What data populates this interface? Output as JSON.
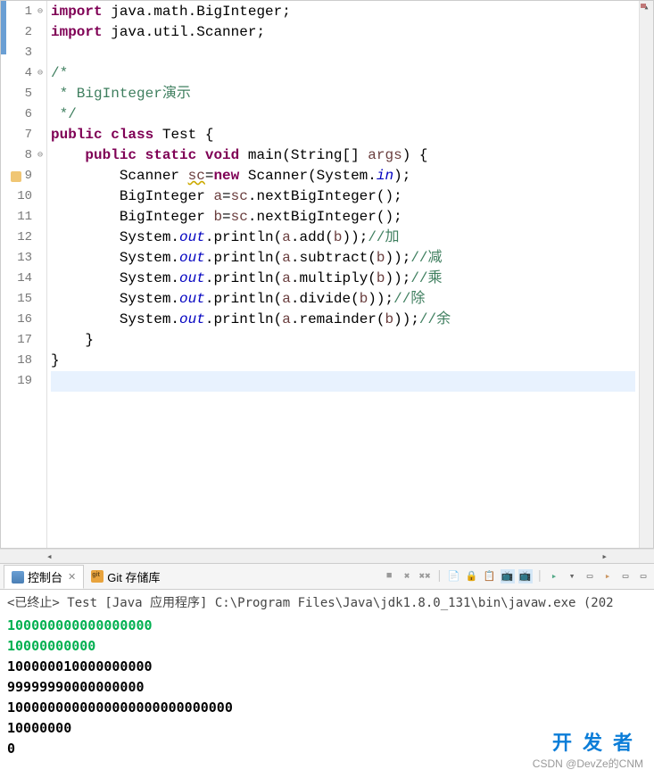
{
  "code": {
    "lines": [
      {
        "n": "1",
        "fold": "⊖",
        "html": "<span class='kw'>import</span> <span class='normal'>java.math.BigInteger;</span>"
      },
      {
        "n": "2",
        "fold": "",
        "html": "<span class='kw'>import</span> <span class='normal'>java.util.Scanner;</span>"
      },
      {
        "n": "3",
        "fold": "",
        "html": ""
      },
      {
        "n": "4",
        "fold": "⊖",
        "html": "<span class='comment'>/*</span>"
      },
      {
        "n": "5",
        "fold": "",
        "html": "<span class='comment'> * BigInteger演示</span>"
      },
      {
        "n": "6",
        "fold": "",
        "html": "<span class='comment'> */</span>"
      },
      {
        "n": "7",
        "fold": "",
        "html": "<span class='kw'>public</span> <span class='kw'>class</span> <span class='normal'>Test {</span>"
      },
      {
        "n": "8",
        "fold": "⊖",
        "html": "    <span class='kw'>public</span> <span class='kw'>static</span> <span class='kw'>void</span> <span class='normal'>main(String[] </span><span class='local-var'>args</span><span class='normal'>) {</span>"
      },
      {
        "n": "9",
        "fold": "",
        "marker": true,
        "html": "        <span class='normal'>Scanner </span><span class='local-var underline'>sc</span><span class='normal'>=</span><span class='kw'>new</span> <span class='normal'>Scanner(System.</span><span class='static-field'>in</span><span class='normal'>);</span>"
      },
      {
        "n": "10",
        "fold": "",
        "html": "        <span class='normal'>BigInteger </span><span class='local-var'>a</span><span class='normal'>=</span><span class='local-var'>sc</span><span class='normal'>.nextBigInteger();</span>"
      },
      {
        "n": "11",
        "fold": "",
        "html": "        <span class='normal'>BigInteger </span><span class='local-var'>b</span><span class='normal'>=</span><span class='local-var'>sc</span><span class='normal'>.nextBigInteger();</span>"
      },
      {
        "n": "12",
        "fold": "",
        "html": "        <span class='normal'>System.</span><span class='static-field'>out</span><span class='normal'>.println(</span><span class='local-var'>a</span><span class='normal'>.add(</span><span class='local-var'>b</span><span class='normal'>));</span><span class='comment'>//加</span>"
      },
      {
        "n": "13",
        "fold": "",
        "html": "        <span class='normal'>System.</span><span class='static-field'>out</span><span class='normal'>.println(</span><span class='local-var'>a</span><span class='normal'>.subtract(</span><span class='local-var'>b</span><span class='normal'>));</span><span class='comment'>//减</span>"
      },
      {
        "n": "14",
        "fold": "",
        "html": "        <span class='normal'>System.</span><span class='static-field'>out</span><span class='normal'>.println(</span><span class='local-var'>a</span><span class='normal'>.multiply(</span><span class='local-var'>b</span><span class='normal'>));</span><span class='comment'>//乘</span>"
      },
      {
        "n": "15",
        "fold": "",
        "html": "        <span class='normal'>System.</span><span class='static-field'>out</span><span class='normal'>.println(</span><span class='local-var'>a</span><span class='normal'>.divide(</span><span class='local-var'>b</span><span class='normal'>));</span><span class='comment'>//除</span>"
      },
      {
        "n": "16",
        "fold": "",
        "html": "        <span class='normal'>System.</span><span class='static-field'>out</span><span class='normal'>.println(</span><span class='local-var'>a</span><span class='normal'>.remainder(</span><span class='local-var'>b</span><span class='normal'>));</span><span class='comment'>//余</span>"
      },
      {
        "n": "17",
        "fold": "",
        "html": "    <span class='normal'>}</span>"
      },
      {
        "n": "18",
        "fold": "",
        "html": "<span class='normal'>}</span>"
      },
      {
        "n": "19",
        "fold": "",
        "highlight": true,
        "html": ""
      }
    ]
  },
  "tabs": {
    "console_label": "控制台",
    "git_label": "Git 存储库"
  },
  "console": {
    "title": "<已终止> Test [Java 应用程序] C:\\Program Files\\Java\\jdk1.8.0_131\\bin\\javaw.exe  (202",
    "lines": [
      {
        "text": "100000000000000000",
        "type": "input"
      },
      {
        "text": "10000000000",
        "type": "input"
      },
      {
        "text": "100000010000000000",
        "type": "output"
      },
      {
        "text": "99999990000000000",
        "type": "output"
      },
      {
        "text": "1000000000000000000000000000",
        "type": "output"
      },
      {
        "text": "10000000",
        "type": "output"
      },
      {
        "text": "0",
        "type": "output"
      }
    ]
  },
  "watermark": {
    "main": "开发者",
    "sub": "CSDN @DevZe的CNM"
  }
}
